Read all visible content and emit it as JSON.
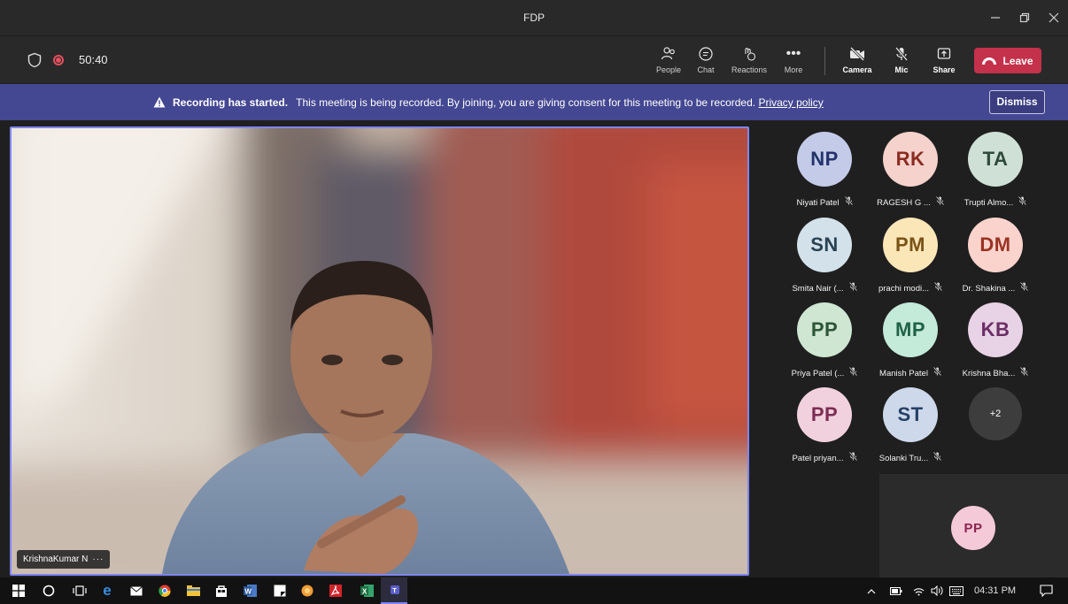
{
  "window": {
    "title": "FDP"
  },
  "toolbar": {
    "timer": "50:40",
    "buttons": [
      {
        "label": "People",
        "icon": "people-icon"
      },
      {
        "label": "Chat",
        "icon": "chat-icon"
      },
      {
        "label": "Reactions",
        "icon": "reactions-icon"
      },
      {
        "label": "More",
        "icon": "more-icon"
      },
      {
        "label": "Camera",
        "icon": "camera-off-icon"
      },
      {
        "label": "Mic",
        "icon": "mic-off-icon"
      },
      {
        "label": "Share",
        "icon": "share-icon"
      }
    ],
    "leave_label": "Leave"
  },
  "banner": {
    "title": "Recording has started.",
    "message": "This meeting is being recorded. By joining, you are giving consent for this meeting to be recorded.",
    "link": "Privacy policy",
    "dismiss_label": "Dismiss"
  },
  "main_video": {
    "name": "KrishnaKumar N",
    "more": "···"
  },
  "participants": [
    {
      "initials": "NP",
      "name": "Niyati Patel",
      "bg": "#c3cbe8",
      "fg": "#23336b"
    },
    {
      "initials": "RK",
      "name": "RAGESH G ...",
      "bg": "#f6d2cd",
      "fg": "#8a2c22"
    },
    {
      "initials": "TA",
      "name": "Trupti Almo...",
      "bg": "#cfe0d6",
      "fg": "#2d4a3a"
    },
    {
      "initials": "SN",
      "name": "Smita Nair (...",
      "bg": "#d2e1ea",
      "fg": "#294252"
    },
    {
      "initials": "PM",
      "name": "prachi modi...",
      "bg": "#fbe6b8",
      "fg": "#7a5316"
    },
    {
      "initials": "DM",
      "name": "Dr. Shakina ...",
      "bg": "#fad4cc",
      "fg": "#9a3324"
    },
    {
      "initials": "PP",
      "name": "Priya Patel (...",
      "bg": "#cfe6d2",
      "fg": "#2d5536"
    },
    {
      "initials": "MP",
      "name": "Manish Patel",
      "bg": "#c4ead9",
      "fg": "#1f6247"
    },
    {
      "initials": "KB",
      "name": "Krishna Bha...",
      "bg": "#e8d2e6",
      "fg": "#6a2e64"
    },
    {
      "initials": "PP",
      "name": "Patel priyan...",
      "bg": "#f2d1df",
      "fg": "#7c2d52"
    },
    {
      "initials": "ST",
      "name": "Solanki Tru...",
      "bg": "#cdd9ea",
      "fg": "#264066"
    }
  ],
  "overflow_count": "+2",
  "self_view": {
    "initials": "PP",
    "bg": "#f4c9d8",
    "fg": "#8c2450"
  },
  "taskbar": {
    "time": "04:31 PM"
  }
}
